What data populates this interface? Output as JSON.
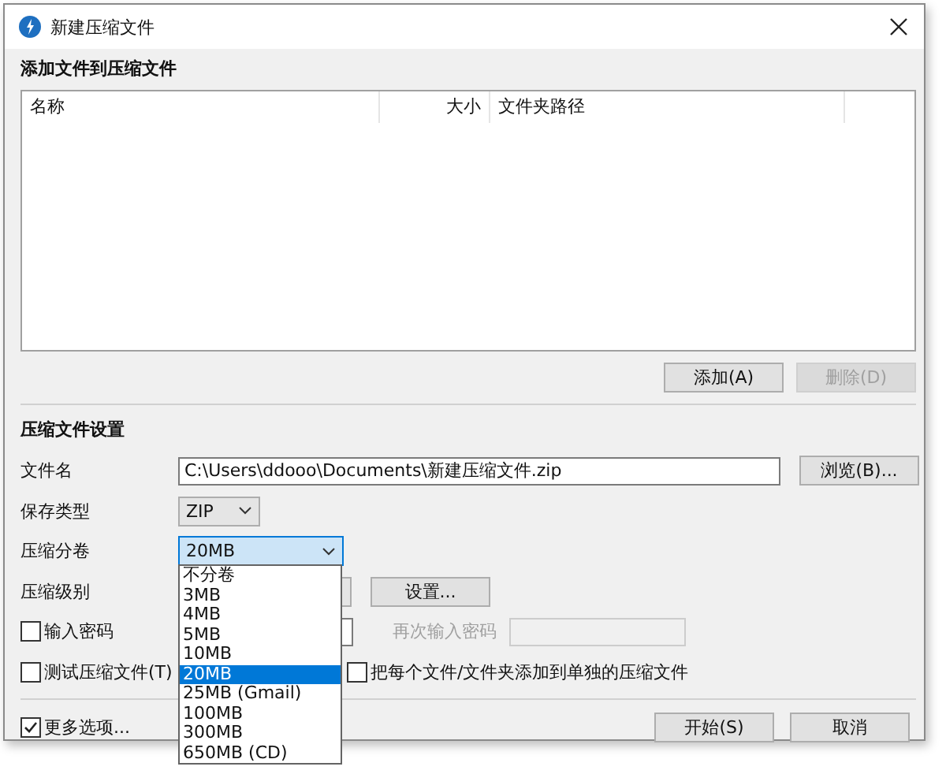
{
  "window": {
    "title": "新建压缩文件"
  },
  "files_section": {
    "heading": "添加文件到压缩文件",
    "columns": [
      "名称",
      "大小",
      "文件夹路径"
    ],
    "buttons": [
      {
        "label": "添加(A)",
        "disabled": false
      },
      {
        "label": "删除(D)",
        "disabled": true
      }
    ]
  },
  "settings": {
    "heading": "压缩文件设置",
    "filename": {
      "label": "文件名",
      "value": "C:\\Users\\ddooo\\Documents\\新建压缩文件.zip",
      "button": "浏览(B)..."
    },
    "save_type": {
      "label": "保存类型",
      "value": "ZIP"
    },
    "split": {
      "label": "压缩分卷",
      "value": "20MB",
      "expanded": true,
      "options": [
        {
          "label": "不分卷",
          "selected": false
        },
        {
          "label": "3MB",
          "selected": false
        },
        {
          "label": "4MB",
          "selected": false
        },
        {
          "label": "5MB",
          "selected": false
        },
        {
          "label": "10MB",
          "selected": false
        },
        {
          "label": "20MB",
          "selected": true
        },
        {
          "label": "25MB (Gmail)",
          "selected": false
        },
        {
          "label": "100MB",
          "selected": false
        },
        {
          "label": "300MB",
          "selected": false
        },
        {
          "label": "650MB (CD)",
          "selected": false
        }
      ]
    },
    "level": {
      "label": "压缩级别",
      "button": "设置..."
    },
    "password": {
      "label": "输入密码",
      "checked": false,
      "confirm_label": "再次输入密码"
    },
    "test": {
      "label": "测试压缩文件(T)",
      "checked": false
    },
    "separate": {
      "label": "把每个文件/文件夹添加到单独的压缩文件",
      "checked": false
    }
  },
  "footer": {
    "more_options": {
      "label": "更多选项...",
      "checked": true
    },
    "buttons": [
      "开始(S)",
      "取消"
    ]
  }
}
